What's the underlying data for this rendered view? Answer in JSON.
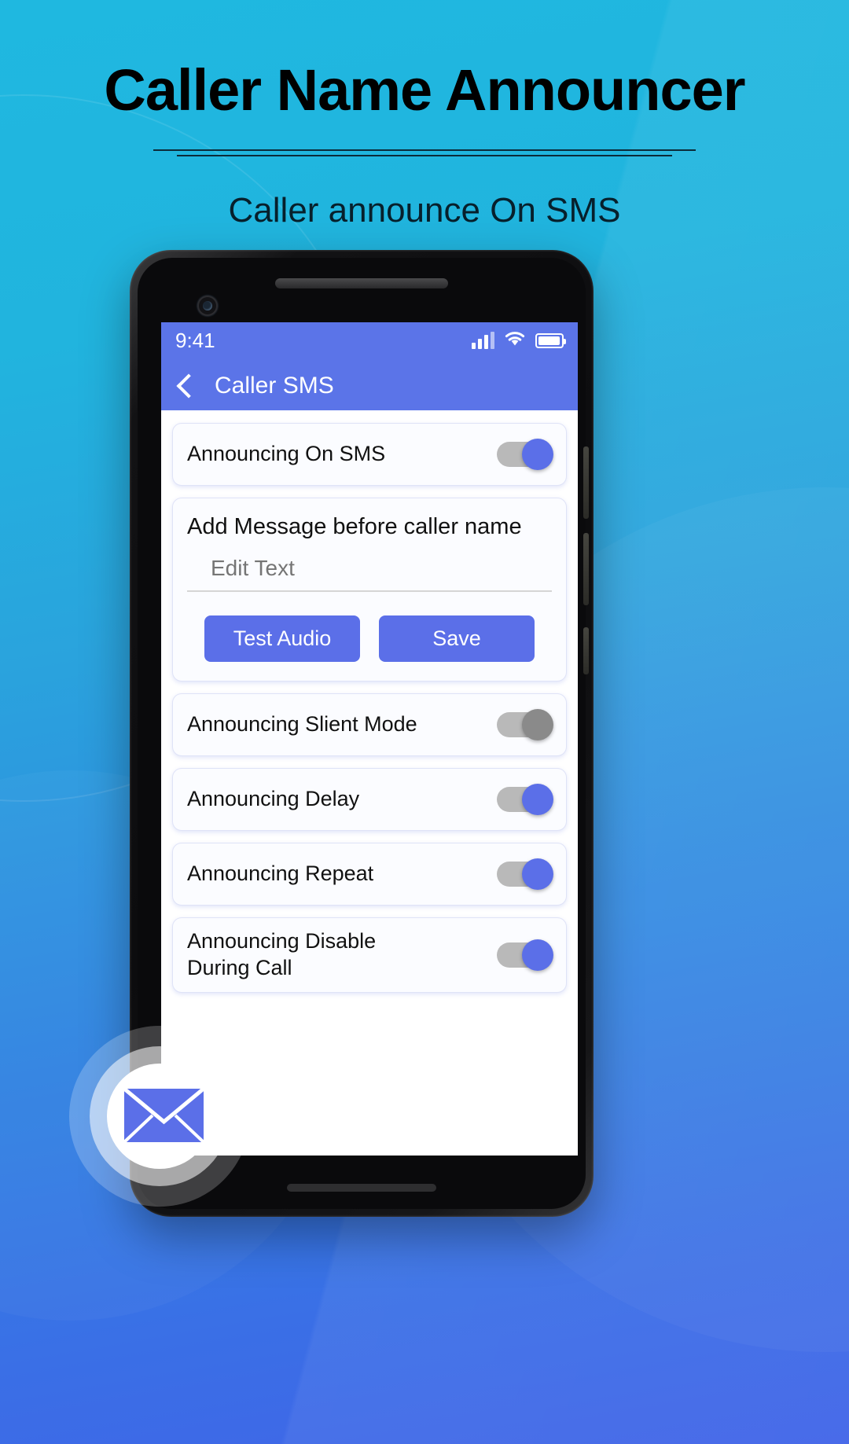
{
  "header": {
    "title": "Caller Name Announcer",
    "subtitle": "Caller announce On SMS"
  },
  "colors": {
    "bg_top": "#1fb8e0",
    "bg_bottom": "#4164e8",
    "accent": "#5b6fe8",
    "appbar": "#5b74e8",
    "toggle_on_knob": "#5b6fe8",
    "toggle_off_knob": "#8a8a8a",
    "toggle_track": "#b9b9b9",
    "card_bg": "#fbfcff"
  },
  "phone": {
    "statusbar": {
      "time": "9:41",
      "icons": [
        "signal-icon",
        "wifi-icon",
        "battery-icon"
      ]
    },
    "appbar": {
      "back_icon": "chevron-left-icon",
      "title": "Caller SMS"
    },
    "cards": [
      {
        "id": "announcing-on-sms",
        "label": "Announcing On SMS",
        "toggle": "on"
      },
      {
        "id": "add-message",
        "title": "Add Message before caller name",
        "input_placeholder": "Edit Text",
        "input_value": "",
        "buttons": [
          {
            "id": "test-audio",
            "label": "Test Audio"
          },
          {
            "id": "save",
            "label": "Save"
          }
        ]
      },
      {
        "id": "announcing-silent-mode",
        "label": "Announcing Slient Mode",
        "toggle": "off"
      },
      {
        "id": "announcing-delay",
        "label": "Announcing Delay",
        "toggle": "on"
      },
      {
        "id": "announcing-repeat",
        "label": "Announcing Repeat",
        "toggle": "on"
      },
      {
        "id": "announcing-disable-during-call",
        "label": "Announcing Disable During Call",
        "toggle": "on"
      }
    ]
  },
  "badge": {
    "icon": "envelope-icon"
  }
}
